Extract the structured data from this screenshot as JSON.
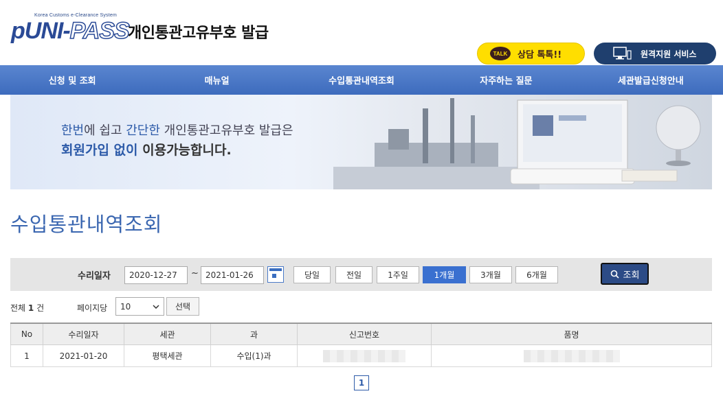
{
  "header": {
    "logo_small": "Korea Customs e-Clearance System",
    "logo_main_a": "pUNI-",
    "logo_main_b": "PASS",
    "site_title": "개인통관고유부호 발급",
    "talk_icon_text": "TALK",
    "talk_label": "상담 톡톡!!",
    "remote_label": "원격지원 서비스"
  },
  "nav": {
    "items": [
      "신청 및 조회",
      "매뉴얼",
      "수입통관내역조회",
      "자주하는 질문",
      "세관발급신청안내"
    ]
  },
  "banner": {
    "line1_a": "한번",
    "line1_b": "에 쉽고 ",
    "line1_c": "간단한",
    "line1_d": " 개인통관고유부호 발급은",
    "line2_a": "회원가입 없이",
    "line2_b": " 이용가능합니다."
  },
  "page_title": "수입통관내역조회",
  "search": {
    "date_label": "수리일자",
    "date_from": "2020-12-27",
    "tilde": "~",
    "date_to": "2021-01-26",
    "periods": [
      "당일",
      "전일",
      "1주일",
      "1개월",
      "3개월",
      "6개월"
    ],
    "active_period": "1개월",
    "search_label": "조회"
  },
  "controls": {
    "total_prefix": "전체",
    "total_count": "1",
    "total_suffix": "건",
    "per_page_label": "페이지당",
    "per_page_value": "10",
    "select_button": "선택"
  },
  "table": {
    "headers": [
      "No",
      "수리일자",
      "세관",
      "과",
      "신고번호",
      "품명"
    ],
    "rows": [
      {
        "no": "1",
        "date": "2021-01-20",
        "customs": "평택세관",
        "division": "수입(1)과"
      }
    ]
  },
  "pagination": {
    "current": "1"
  },
  "colors": {
    "nav": "#4a78c6",
    "title": "#3a66b0",
    "active_period": "#3a70d0",
    "search_button": "#2c4b86",
    "talk": "#ffde00",
    "remote": "#1f3f6e"
  }
}
